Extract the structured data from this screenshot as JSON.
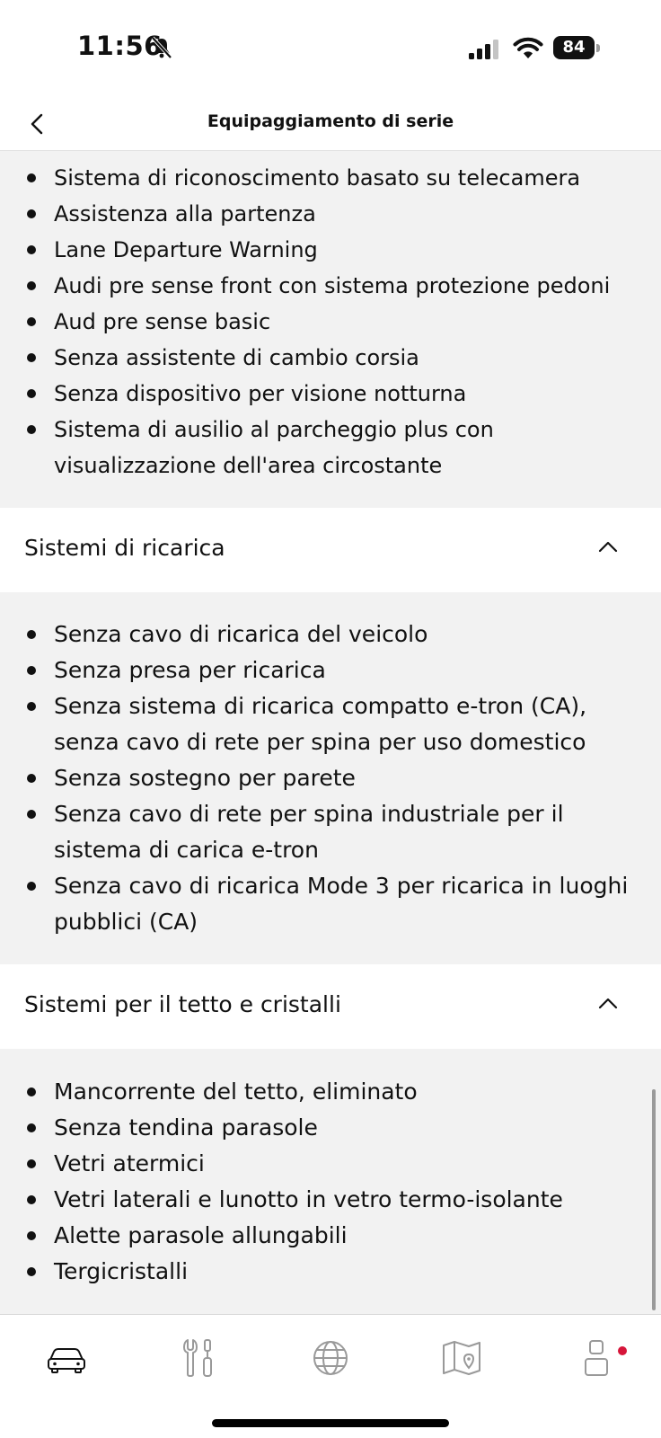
{
  "status_bar": {
    "time": "11:56",
    "battery": "84"
  },
  "header": {
    "title": "Equipaggiamento di serie"
  },
  "sections": [
    {
      "items": [
        "Sistema di riconoscimento basato su telecamera",
        "Assistenza alla partenza",
        "Lane Departure Warning",
        "Audi pre sense front con sistema protezione pedoni",
        "Aud pre sense basic",
        "Senza assistente di cambio corsia",
        "Senza dispositivo per visione notturna",
        "Sistema di ausilio al parcheggio plus con visualizzazione dell'area circostante"
      ]
    },
    {
      "title": "Sistemi di ricarica",
      "items": [
        "Senza cavo di ricarica del veicolo",
        "Senza presa per ricarica",
        "Senza sistema di ricarica compatto e-tron (CA), senza cavo di rete per spina per uso domestico",
        "Senza sostegno per parete",
        "Senza cavo di rete per spina industriale per il sistema di carica e-tron",
        "Senza cavo di ricarica Mode 3 per ricarica in luoghi pubblici (CA)"
      ]
    },
    {
      "title": "Sistemi per il tetto e cristalli",
      "items": [
        "Mancorrente del tetto, eliminato",
        "Senza tendina parasole",
        "Vetri atermici",
        "Vetri laterali e lunotto in vetro termo-isolante",
        "Alette parasole allungabili",
        "Tergicristalli"
      ]
    }
  ],
  "tab_bar": {
    "tabs": [
      {
        "icon": "car-icon"
      },
      {
        "icon": "service-tools-icon"
      },
      {
        "icon": "globe-icon"
      },
      {
        "icon": "map-icon"
      },
      {
        "icon": "profile-icon"
      }
    ],
    "notification_color": "#d6153a"
  }
}
